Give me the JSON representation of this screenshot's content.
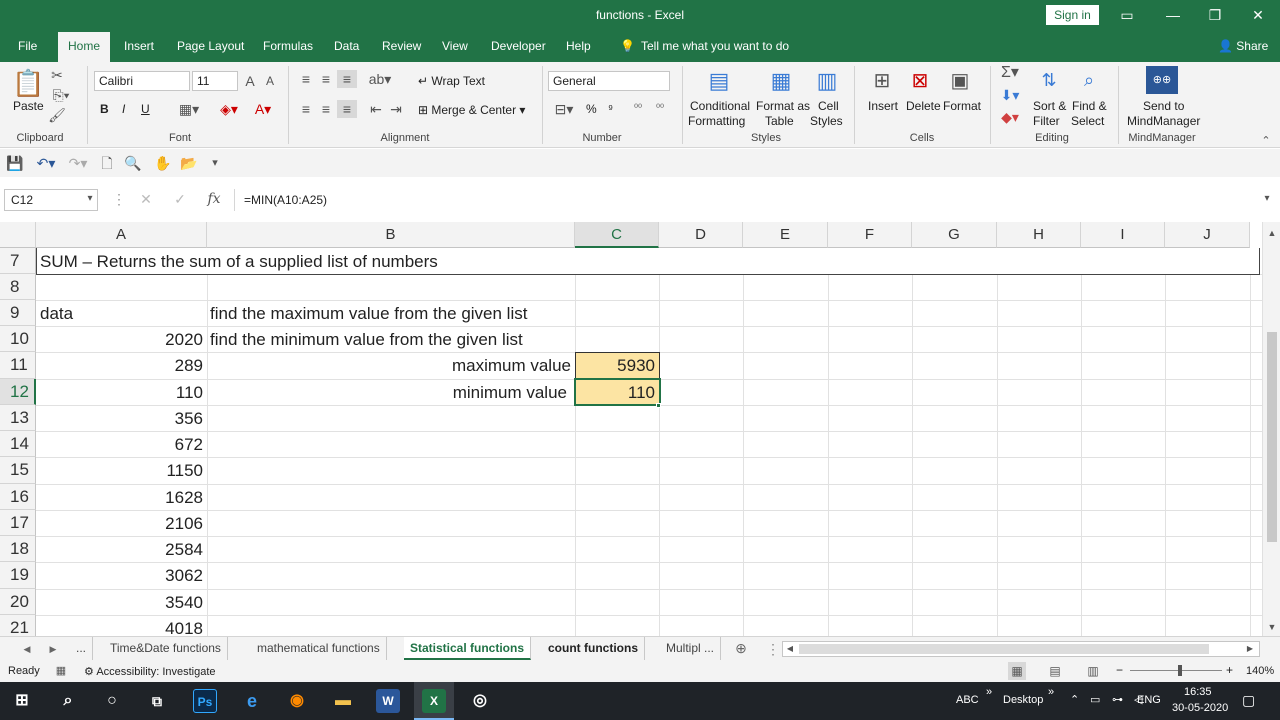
{
  "window": {
    "title": "functions  -  Excel",
    "sign_in": "Sign in"
  },
  "tabs": [
    {
      "label": "File"
    },
    {
      "label": "Home"
    },
    {
      "label": "Insert"
    },
    {
      "label": "Page Layout"
    },
    {
      "label": "Formulas"
    },
    {
      "label": "Data"
    },
    {
      "label": "Review"
    },
    {
      "label": "View"
    },
    {
      "label": "Developer"
    },
    {
      "label": "Help"
    }
  ],
  "tell_me": "Tell me what you want to do",
  "share": "Share",
  "ribbon": {
    "clipboard": {
      "label": "Clipboard",
      "paste": "Paste"
    },
    "font": {
      "label": "Font",
      "name": "Calibri",
      "size": "11",
      "bold": "B",
      "italic": "I",
      "underline": "U"
    },
    "alignment": {
      "label": "Alignment",
      "wrap": "Wrap Text",
      "merge": "Merge & Center"
    },
    "number": {
      "label": "Number",
      "format": "General",
      "percent": "%",
      "comma": "⁹"
    },
    "styles": {
      "label": "Styles",
      "cond1": "Conditional",
      "cond2": "Formatting",
      "fmt1": "Format as",
      "fmt2": "Table",
      "cell1": "Cell",
      "cell2": "Styles"
    },
    "cells": {
      "label": "Cells",
      "insert": "Insert",
      "delete": "Delete",
      "format": "Format"
    },
    "editing": {
      "label": "Editing",
      "sort1": "Sort &",
      "sort2": "Filter",
      "find1": "Find &",
      "find2": "Select"
    },
    "mindmanager": {
      "label": "MindManager",
      "send1": "Send to",
      "send2": "MindManager"
    }
  },
  "formula_bar": {
    "name_box": "C12",
    "fx": "fx",
    "formula": "=MIN(A10:A25)"
  },
  "columns": [
    "A",
    "B",
    "C",
    "D",
    "E",
    "F",
    "G",
    "H",
    "I",
    "J"
  ],
  "selected_column": "C",
  "rows": [
    {
      "num": "7"
    },
    {
      "num": "8"
    },
    {
      "num": "9"
    },
    {
      "num": "10"
    },
    {
      "num": "11"
    },
    {
      "num": "12"
    },
    {
      "num": "13"
    },
    {
      "num": "14"
    },
    {
      "num": "15"
    },
    {
      "num": "16"
    },
    {
      "num": "17"
    },
    {
      "num": "18"
    },
    {
      "num": "19"
    },
    {
      "num": "20"
    },
    {
      "num": "21"
    }
  ],
  "cells": {
    "a7": "SUM – Returns the sum of a supplied list of numbers",
    "a9": "data",
    "b9": "find the maximum value from the given list",
    "b10": "find the minimum value from the given list",
    "b11": "maximum value",
    "b12": "minimum value",
    "c11": "5930",
    "c12": "110",
    "a_values": [
      "2020",
      "289",
      "110",
      "356",
      "672",
      "1150",
      "1628",
      "2106",
      "2584",
      "3062",
      "3540",
      "4018"
    ]
  },
  "sheets": {
    "more": "...",
    "tabs": [
      {
        "label": "Time&Date functions"
      },
      {
        "label": "mathematical functions"
      },
      {
        "label": "Statistical functions"
      },
      {
        "label": "count functions"
      },
      {
        "label": "Multipl  ..."
      }
    ],
    "active": "Statistical functions"
  },
  "status": {
    "ready": "Ready",
    "accessibility": "Accessibility: Investigate",
    "zoom": "140%"
  },
  "taskbar": {
    "abc": "ABC",
    "desktop": "Desktop",
    "lang": "ENG",
    "time": "16:35",
    "date": "30-05-2020"
  },
  "colors": {
    "excel_green": "#217346",
    "highlight": "#fce4a3"
  }
}
